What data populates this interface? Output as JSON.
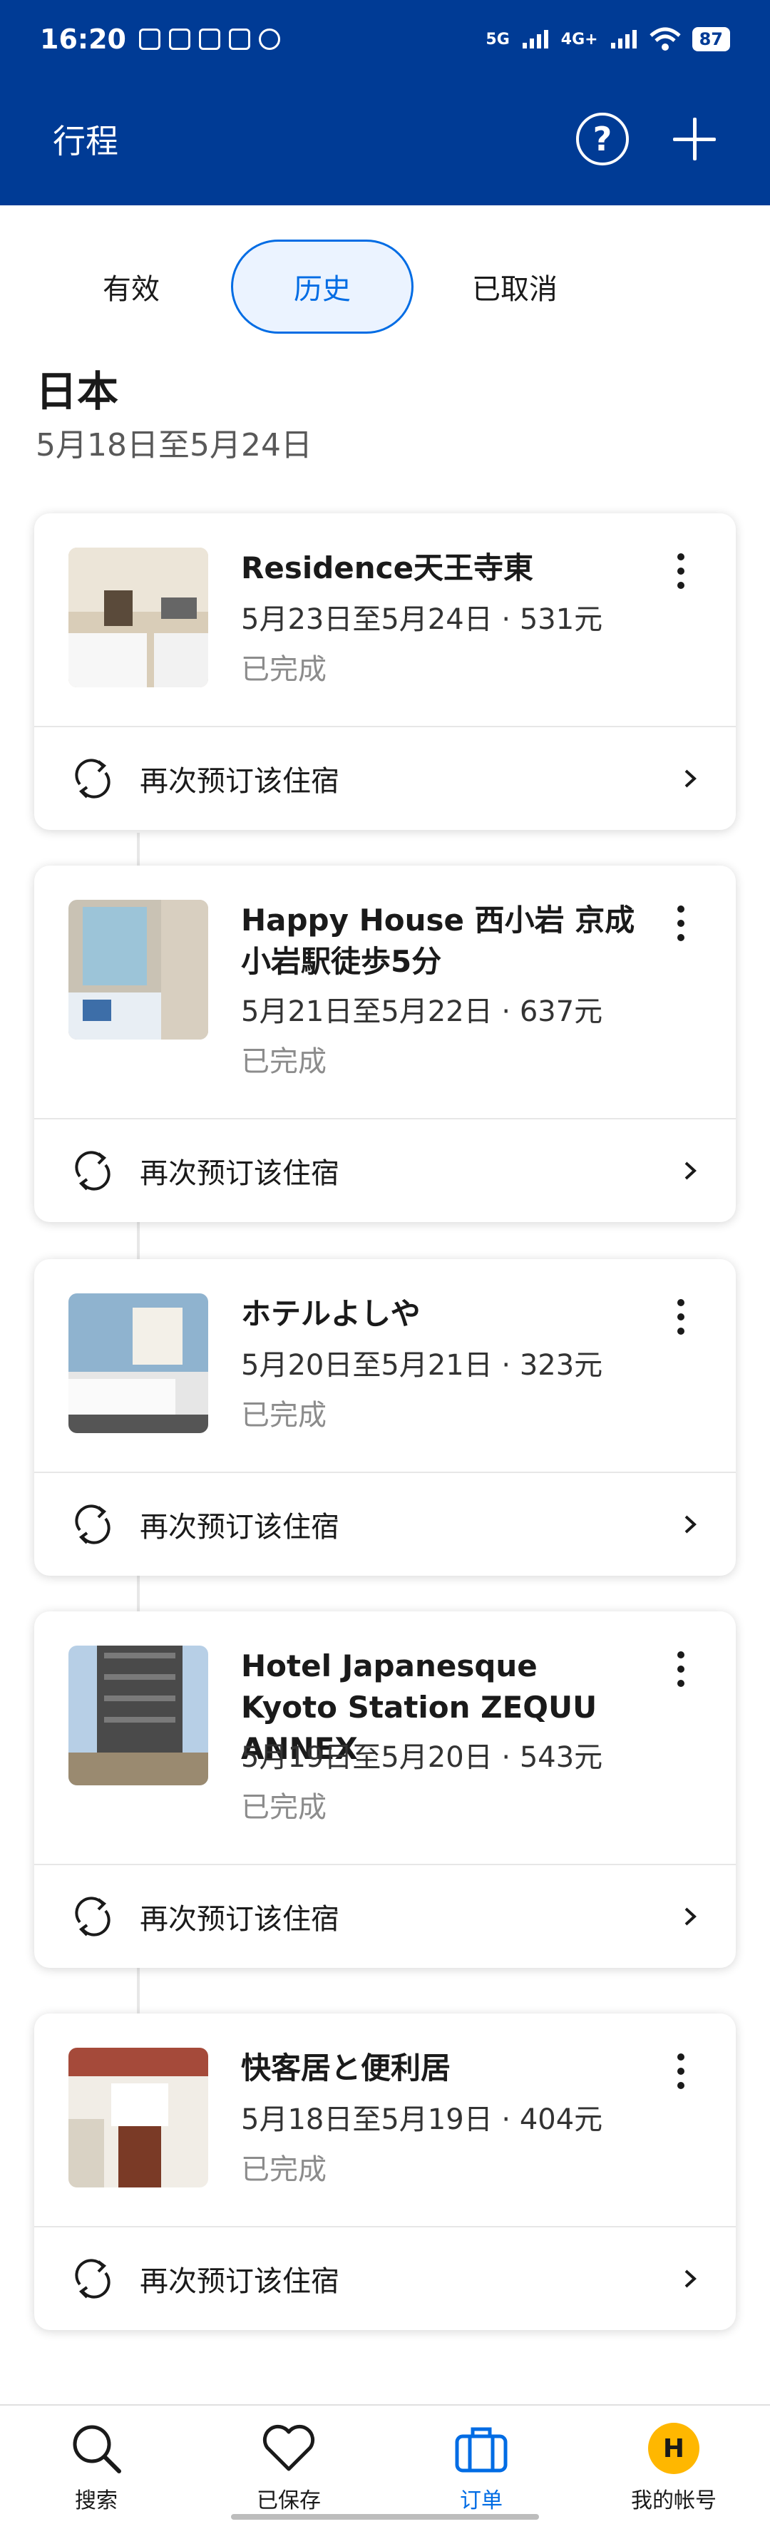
{
  "status_bar": {
    "time": "16:20",
    "network": "5G",
    "network2": "4G+",
    "battery": "87"
  },
  "header": {
    "title": "行程"
  },
  "tabs": [
    {
      "label": "有效"
    },
    {
      "label": "历史"
    },
    {
      "label": "已取消"
    }
  ],
  "section": {
    "country": "日本",
    "date_range": "5月18日至5月24日"
  },
  "rebook_label": "再次预订该住宿",
  "bookings": [
    {
      "name": "Residence天王寺東",
      "dates": "5月23日至5月24日 · 531元",
      "status": "已完成"
    },
    {
      "name": "Happy House 西小岩 京成小岩駅徒歩5分",
      "dates": "5月21日至5月22日 · 637元",
      "status": "已完成"
    },
    {
      "name": "ホテルよしや",
      "dates": "5月20日至5月21日 · 323元",
      "status": "已完成"
    },
    {
      "name": "Hotel Japanesque Kyoto Station ZEQUU ANNEX",
      "dates": "5月19日至5月20日 · 543元",
      "status": "已完成"
    },
    {
      "name": "快客居と便利居",
      "dates": "5月18日至5月19日 · 404元",
      "status": "已完成"
    }
  ],
  "bottom_nav": [
    {
      "label": "搜索",
      "icon": "search-icon"
    },
    {
      "label": "已保存",
      "icon": "heart-icon"
    },
    {
      "label": "订单",
      "icon": "suitcase-icon"
    },
    {
      "label": "我的帐号",
      "icon": "avatar",
      "avatar_letter": "H"
    }
  ],
  "colors": {
    "brand": "#003b95",
    "accent": "#006ce4",
    "avatar": "#ffb700"
  }
}
